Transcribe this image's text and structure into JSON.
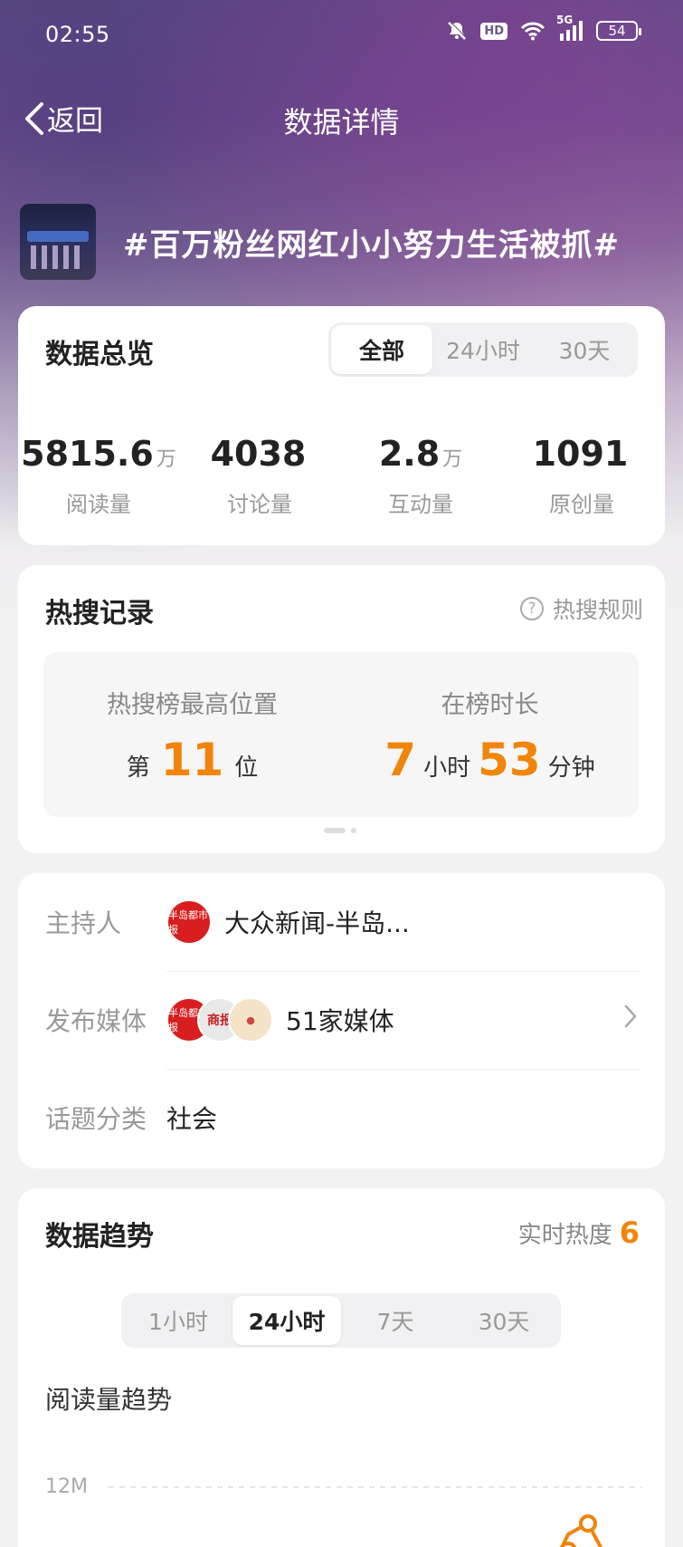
{
  "status_bar": {
    "time": "02:55",
    "icons": [
      "bell-off-icon",
      "hd-icon",
      "wifi-icon",
      "signal-5g-icon"
    ],
    "hd_label": "HD",
    "network": "5G",
    "battery": "54"
  },
  "nav": {
    "back_label": "返回",
    "title": "数据详情"
  },
  "topic": {
    "title": "#百万粉丝网红小小努力生活被抓#"
  },
  "overview": {
    "title": "数据总览",
    "tabs": [
      "全部",
      "24小时",
      "30天"
    ],
    "active_tab": "全部",
    "stats": [
      {
        "value": "5815.6",
        "unit": "万",
        "label": "阅读量"
      },
      {
        "value": "4038",
        "unit": "",
        "label": "讨论量"
      },
      {
        "value": "2.8",
        "unit": "万",
        "label": "互动量"
      },
      {
        "value": "1091",
        "unit": "",
        "label": "原创量"
      }
    ]
  },
  "hot_search": {
    "title": "热搜记录",
    "rule_label": "热搜规则",
    "rule_icon": "question-icon",
    "peak_label": "热搜榜最高位置",
    "peak_prefix": "第",
    "peak_value": "11",
    "peak_suffix": "位",
    "duration_label": "在榜时长",
    "duration_hours": "7",
    "hours_unit": "小时",
    "duration_minutes": "53",
    "minutes_unit": "分钟"
  },
  "info": {
    "host_label": "主持人",
    "host_name": "大众新闻-半岛...",
    "media_label": "发布媒体",
    "media_count": "51家媒体",
    "category_label": "话题分类",
    "category_value": "社会",
    "brand_color": "#d81e1e"
  },
  "trend": {
    "title": "数据趋势",
    "heat_label": "实时热度",
    "heat_value": "6",
    "tabs": [
      "1小时",
      "24小时",
      "7天",
      "30天"
    ],
    "active_tab": "24小时",
    "sub_title": "阅读量趋势",
    "y_tick": "12M",
    "accent_color": "#f0850a"
  }
}
